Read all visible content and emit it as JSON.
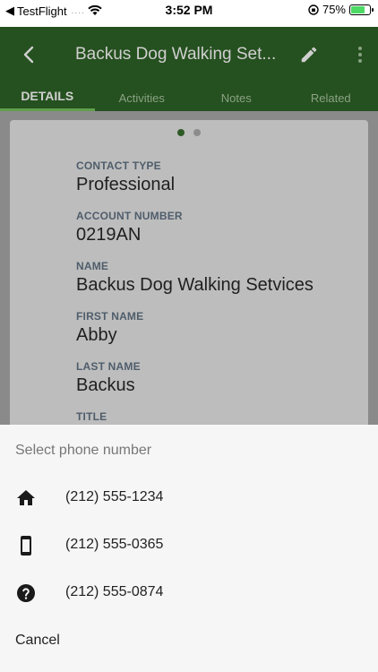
{
  "status_bar": {
    "back_app": "TestFlight",
    "signal_dots": "....",
    "time": "3:52 PM",
    "battery_percent": "75%",
    "battery_level": 0.75
  },
  "app_bar": {
    "title": "Backus Dog Walking Set...",
    "tabs": [
      {
        "label": "DETAILS",
        "active": true
      },
      {
        "label": "Activities",
        "active": false
      },
      {
        "label": "Notes",
        "active": false
      },
      {
        "label": "Related",
        "active": false
      }
    ]
  },
  "pager": {
    "pages": 2,
    "active_index": 0
  },
  "fields": [
    {
      "label": "CONTACT TYPE",
      "value": "Professional"
    },
    {
      "label": "ACCOUNT NUMBER",
      "value": "0219AN"
    },
    {
      "label": "NAME",
      "value": "Backus Dog Walking Setvices"
    },
    {
      "label": "FIRST NAME",
      "value": "Abby"
    },
    {
      "label": "LAST NAME",
      "value": "Backus"
    },
    {
      "label": "TITLE",
      "value": ""
    }
  ],
  "sheet": {
    "title": "Select phone number",
    "phones": [
      {
        "icon": "home-icon",
        "number": "(212) 555-1234"
      },
      {
        "icon": "mobile-phone-icon",
        "number": "(212) 555-0365"
      },
      {
        "icon": "help-icon",
        "number": "(212) 555-0874"
      }
    ],
    "cancel_label": "Cancel"
  },
  "colors": {
    "app_bar": "#25501f",
    "accent": "#5fa04b",
    "scrim_sheet": "#f6f6f6"
  }
}
